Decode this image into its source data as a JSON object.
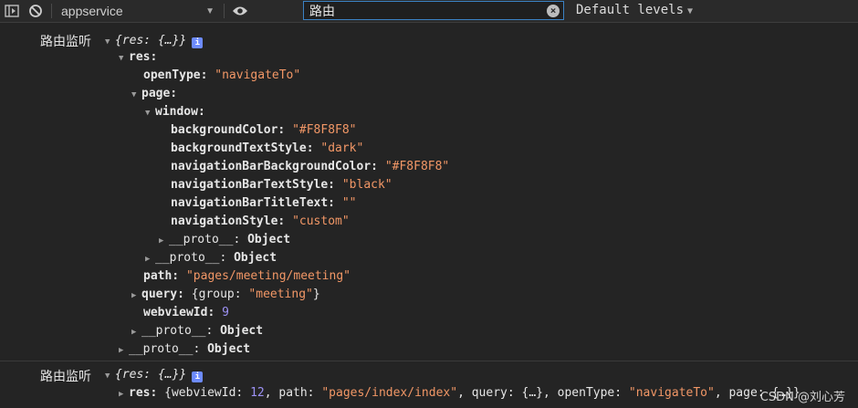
{
  "toolbar": {
    "context": "appservice",
    "filter_value": "路由",
    "levels": "Default levels"
  },
  "messages": [
    {
      "prefix": "路由监听",
      "summary_key": "{res: {…}}",
      "lines": [
        {
          "k": "res:"
        },
        {
          "k": "openType:",
          "v": "\"navigateTo\""
        },
        {
          "k": "page:"
        },
        {
          "k": "window:"
        },
        {
          "k": "backgroundColor:",
          "v": "\"#F8F8F8\""
        },
        {
          "k": "backgroundTextStyle:",
          "v": "\"dark\""
        },
        {
          "k": "navigationBarBackgroundColor:",
          "v": "\"#F8F8F8\""
        },
        {
          "k": "navigationBarTextStyle:",
          "v": "\"black\""
        },
        {
          "k": "navigationBarTitleText:",
          "v": "\"\""
        },
        {
          "k": "navigationStyle:",
          "v": "\"custom\""
        },
        {
          "k": "__proto__:",
          "v": "Object"
        },
        {
          "k": "__proto__:",
          "v": "Object"
        },
        {
          "k": "path:",
          "v": "\"pages/meeting/meeting\""
        },
        {
          "k": "query:",
          "v1": "{group: ",
          "v2": "\"meeting\"",
          "v3": "}"
        },
        {
          "k": "webviewId:",
          "v": "9"
        },
        {
          "k": "__proto__:",
          "v": "Object"
        },
        {
          "k": "__proto__:",
          "v": "Object"
        }
      ]
    },
    {
      "prefix": "路由监听",
      "summary_key": "{res: {…}}",
      "res_line": {
        "k": "res:",
        "a": "{webviewId: ",
        "b": "12",
        "c": ", path: ",
        "d": "\"pages/index/index\"",
        "e": ", query: {…}, openType: ",
        "f": "\"navigateTo\"",
        "g": ", page: {…}}"
      },
      "watermark": "CSDN @刘心芳"
    }
  ]
}
